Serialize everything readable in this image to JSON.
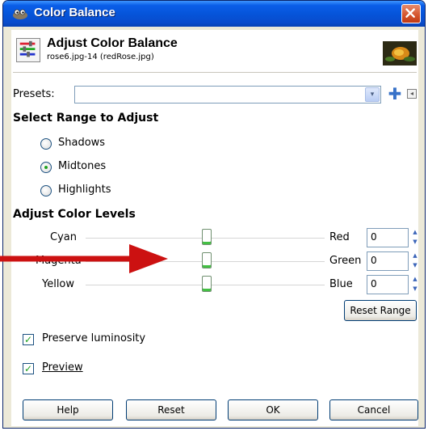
{
  "window": {
    "title": "Color Balance",
    "close_symbol": "✕"
  },
  "header": {
    "title": "Adjust Color Balance",
    "subtitle": "rose6.jpg-14 (redRose.jpg)"
  },
  "presets": {
    "label": "Presets:",
    "value": "",
    "dropdown_symbol": "▾",
    "add_symbol": "✚",
    "menu_symbol": "◂"
  },
  "range": {
    "heading": "Select Range to Adjust",
    "options": [
      {
        "label": "Shadows",
        "checked": false
      },
      {
        "label": "Midtones",
        "checked": true
      },
      {
        "label": "Highlights",
        "checked": false
      }
    ]
  },
  "levels": {
    "heading": "Adjust Color Levels",
    "rows": [
      {
        "left": "Cyan",
        "right": "Red",
        "value": "0"
      },
      {
        "left": "Magenta",
        "right": "Green",
        "value": "0"
      },
      {
        "left": "Yellow",
        "right": "Blue",
        "value": "0"
      }
    ],
    "spin_up": "▲",
    "spin_down": "▼"
  },
  "reset_range_label": "Reset Range",
  "checks": [
    {
      "label": "Preserve luminosity",
      "checked": true,
      "mark": "✓"
    },
    {
      "label": "Preview",
      "checked": true,
      "mark": "✓"
    }
  ],
  "buttons": {
    "help": "Help",
    "reset": "Reset",
    "ok": "OK",
    "cancel": "Cancel"
  },
  "colors": {
    "titlebar": "#0553d8",
    "arrow": "#cc1111",
    "handle_accent": "#43c043"
  }
}
